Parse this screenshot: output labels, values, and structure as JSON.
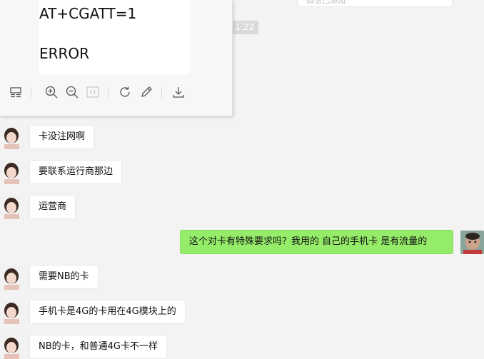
{
  "header": {
    "partial_text": "微信已添加",
    "time": "1:22"
  },
  "viewer": {
    "image_lines": [
      "AT+CGATT=1",
      "ERROR"
    ]
  },
  "messages": [
    {
      "side": "in",
      "text": "卡没注网啊"
    },
    {
      "side": "in",
      "text": "要联系运行商那边"
    },
    {
      "side": "in",
      "text": "运营商"
    },
    {
      "side": "out",
      "text": "这个对卡有特殊要求吗？我用的 自己的手机卡  是有流量的"
    },
    {
      "side": "in",
      "text": "需要NB的卡"
    },
    {
      "side": "in",
      "text": "手机卡是4G的卡用在4G模块上的"
    },
    {
      "side": "in",
      "text": "NB的卡，和普通4G卡不一样"
    }
  ],
  "colors": {
    "incoming_bubble": "#ffffff",
    "outgoing_bubble": "#95ec69",
    "background": "#f3f3f3"
  }
}
